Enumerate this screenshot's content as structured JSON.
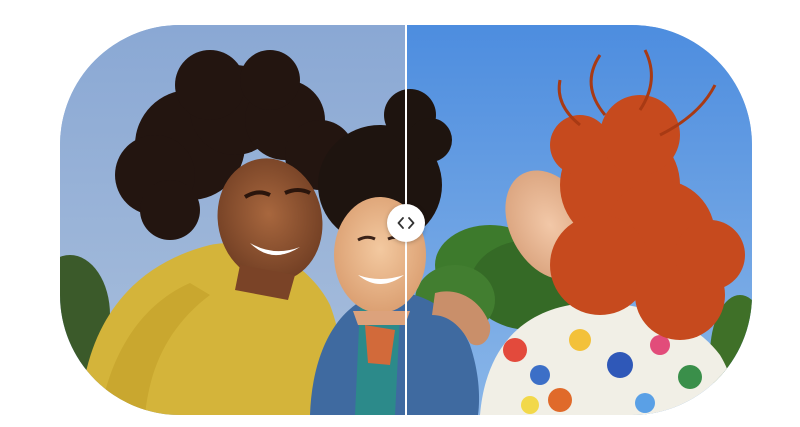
{
  "comparison": {
    "divider_position_percent": 50,
    "handle_icon": "chevron-left-right-icon",
    "colors": {
      "sky_left": "#7f9fcf",
      "sky_right": "#5b95de",
      "sweater": "#d4b43a",
      "denim": "#3f6aa0",
      "red_hair": "#c64a1e",
      "dark_hair": "#2a1a12",
      "foliage": "#3c6a2a"
    }
  }
}
